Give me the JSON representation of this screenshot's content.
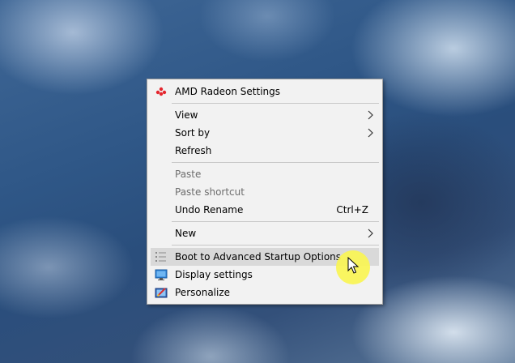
{
  "menu": {
    "items": [
      {
        "label": "AMD Radeon Settings",
        "icon": "amd-radeon-icon"
      },
      {
        "label": "View",
        "submenu": true
      },
      {
        "label": "Sort by",
        "submenu": true
      },
      {
        "label": "Refresh"
      },
      {
        "label": "Paste",
        "disabled": true
      },
      {
        "label": "Paste shortcut",
        "disabled": true
      },
      {
        "label": "Undo Rename",
        "shortcut": "Ctrl+Z"
      },
      {
        "label": "New",
        "submenu": true
      },
      {
        "label": "Boot to Advanced Startup Options",
        "icon": "list-icon",
        "highlighted": true
      },
      {
        "label": "Display settings",
        "icon": "display-icon"
      },
      {
        "label": "Personalize",
        "icon": "personalize-icon"
      }
    ]
  },
  "colors": {
    "menu_bg": "#f2f2f2",
    "hover_bg": "#d9d9d9",
    "disabled_text": "#6d6d6d",
    "amd_red": "#e4262e",
    "cursor_highlight": "#faf550"
  }
}
